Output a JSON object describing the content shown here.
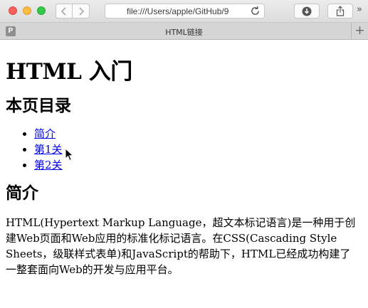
{
  "browser": {
    "url": "file:///Users/apple/GitHub/9",
    "tab_title": "HTML链接",
    "pinned_tab_letter": "P",
    "new_tab_glyph": "+",
    "more_glyph": "»",
    "icons": [
      "back-icon",
      "forward-icon",
      "reload-icon",
      "download-icon",
      "share-icon"
    ]
  },
  "page": {
    "title": "HTML 入门",
    "toc_heading": "本页目录",
    "toc": [
      {
        "label": "简介"
      },
      {
        "label": "第1关"
      },
      {
        "label": "第2关"
      }
    ],
    "intro_heading": "简介",
    "intro_text": "HTML(Hypertext Markup Language，超文本标记语言)是一种用于创建Web页面和Web应用的标准化标记语言。在CSS(Cascading Style Sheets，级联样式表单)和JavaScript的帮助下，HTML已经成功构建了一整套面向Web的开发与应用平台。"
  },
  "colors": {
    "link": "#0000ee",
    "close": "#fc605c",
    "minimize": "#fdbc40",
    "zoom": "#34c84a"
  }
}
